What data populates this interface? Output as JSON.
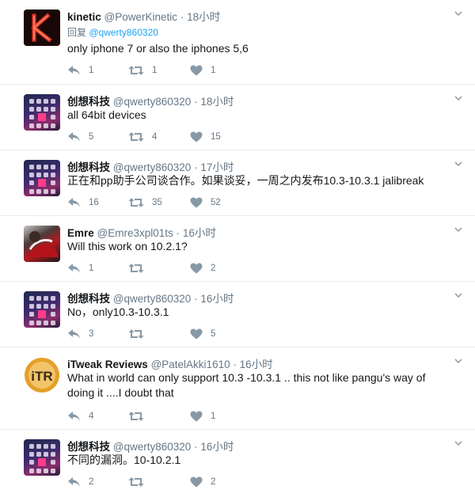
{
  "tweets": [
    {
      "name": "kinetic",
      "handle": "@PowerKinetic",
      "time": "18小时",
      "reply_prefix": "回复",
      "reply_mention": "@qwerty860320",
      "text": "only iphone 7 or also the iphones 5,6",
      "reply_count": "1",
      "retweet_count": "1",
      "like_count": "1",
      "avatar": "kinetic-logo"
    },
    {
      "name": "创想科技",
      "handle": "@qwerty860320",
      "time": "18小时",
      "text": "all 64bit devices",
      "reply_count": "5",
      "retweet_count": "4",
      "like_count": "15",
      "avatar": "phone-homescreen"
    },
    {
      "name": "创想科技",
      "handle": "@qwerty860320",
      "time": "17小时",
      "text": "正在和pp助手公司谈合作。如果谈妥，一周之内发布10.3-10.3.1 jalibreak",
      "reply_count": "16",
      "retweet_count": "35",
      "like_count": "52",
      "avatar": "phone-homescreen"
    },
    {
      "name": "Emre",
      "handle": "@Emre3xpl01ts",
      "time": "16小时",
      "text": "Will this work on 10.2.1?",
      "reply_count": "1",
      "retweet_count": "",
      "like_count": "2",
      "avatar": "emre-photo"
    },
    {
      "name": "创想科技",
      "handle": "@qwerty860320",
      "time": "16小时",
      "text": "No，only10.3-10.3.1",
      "reply_count": "3",
      "retweet_count": "",
      "like_count": "5",
      "avatar": "phone-homescreen"
    },
    {
      "name": "iTweak Reviews",
      "handle": "@PatelAkki1610",
      "time": "16小时",
      "text": "What in world can only support 10.3 -10.3.1 .. this not like pangu's way of doing it ....I doubt that",
      "reply_count": "4",
      "retweet_count": "",
      "like_count": "1",
      "avatar": "itr-logo",
      "avatar_text": "iTR"
    },
    {
      "name": "创想科技",
      "handle": "@qwerty860320",
      "time": "16小时",
      "text": "不同的漏洞。10-10.2.1",
      "reply_count": "2",
      "retweet_count": "",
      "like_count": "2",
      "avatar": "phone-homescreen"
    }
  ],
  "separator": "·",
  "colors": {
    "accent": "#1da1f2",
    "muted": "#657786",
    "text": "#14171a",
    "border": "#e6ecf0"
  }
}
